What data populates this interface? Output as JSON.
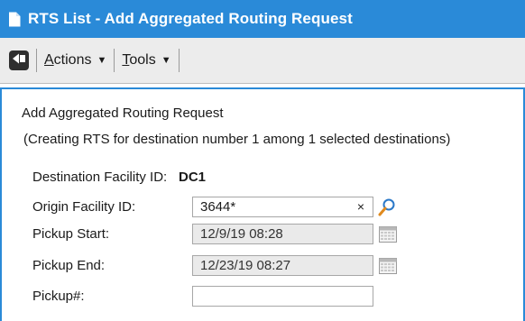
{
  "window": {
    "title": "RTS List - Add Aggregated Routing Request",
    "accent_color": "#2a8ad8"
  },
  "toolbar": {
    "back_icon": "back-arrow-icon",
    "actions_label": "Actions",
    "tools_label": "Tools"
  },
  "form": {
    "heading": "Add Aggregated Routing Request",
    "subheading": "(Creating RTS for destination number 1 among 1 selected destinations)",
    "destination": {
      "label": "Destination Facility ID:",
      "value": "DC1"
    },
    "origin": {
      "label": "Origin Facility ID:",
      "value": "3644*",
      "clear_glyph": "×",
      "icon": "search-icon"
    },
    "pickup_start": {
      "label": "Pickup Start:",
      "value": "12/9/19 08:28",
      "icon": "calendar-icon"
    },
    "pickup_end": {
      "label": "Pickup End:",
      "value": "12/23/19 08:27",
      "icon": "calendar-icon"
    },
    "pickup_number": {
      "label": "Pickup#:",
      "value": ""
    }
  }
}
